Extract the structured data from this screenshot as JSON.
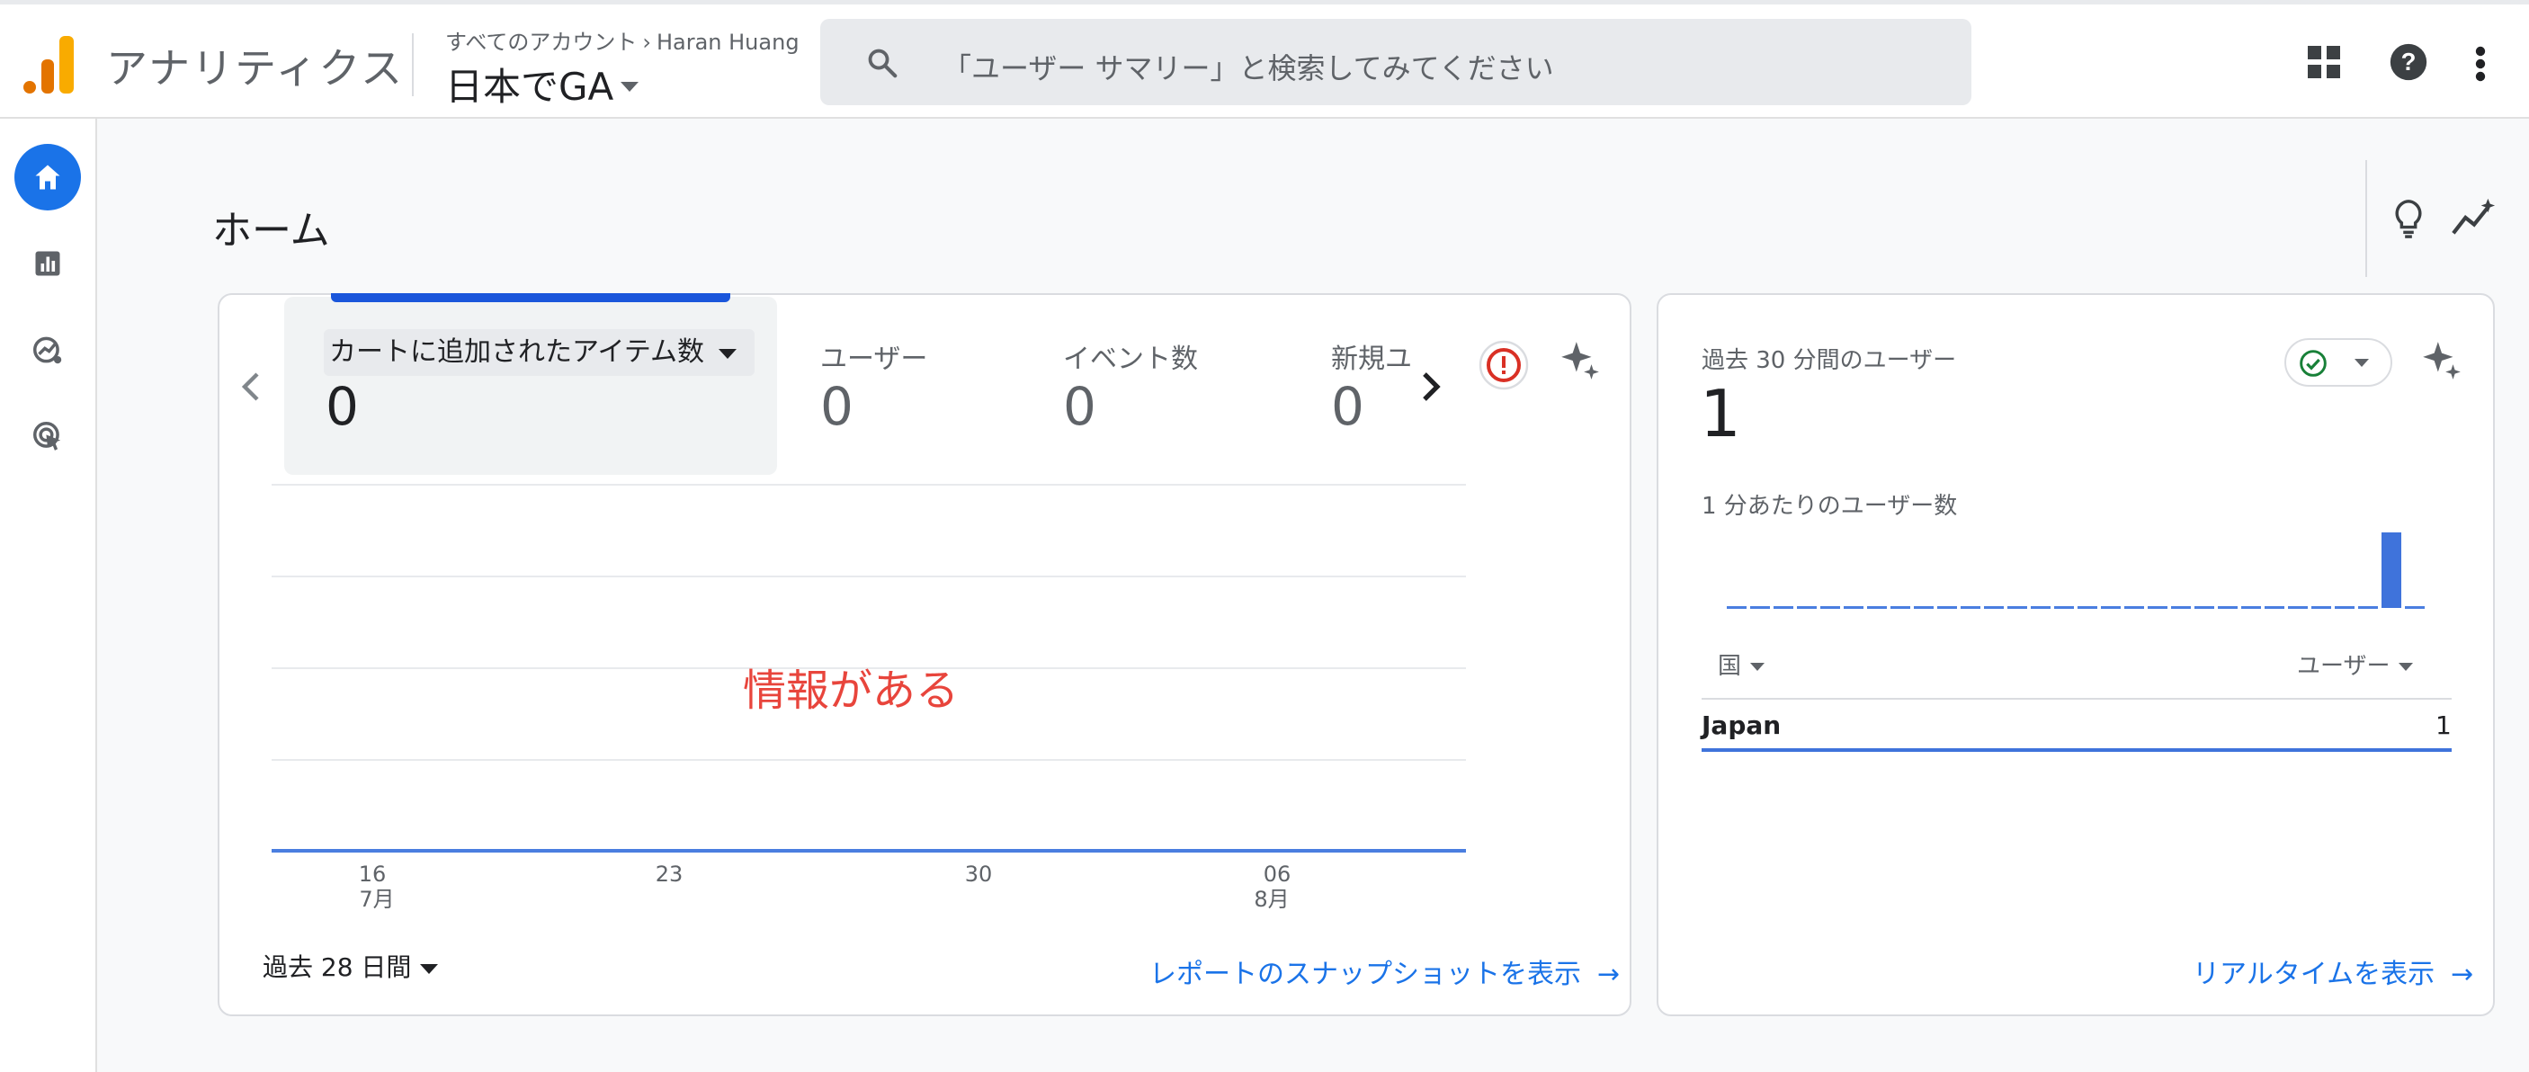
{
  "header": {
    "product_name": "アナリティクス",
    "breadcrumb_root": "すべてのアカウント",
    "breadcrumb_separator": "›",
    "account_name": "Haran Huang",
    "property_name": "日本でGA",
    "search_placeholder": "「ユーザー サマリー」と検索してみてください",
    "icons": [
      "search-icon",
      "apps-grid-icon",
      "help-icon",
      "more-vert-icon"
    ]
  },
  "nav": {
    "items": [
      {
        "icon": "home-icon",
        "active": true
      },
      {
        "icon": "reports-icon",
        "active": false
      },
      {
        "icon": "explore-icon",
        "active": false
      },
      {
        "icon": "advertising-icon",
        "active": false
      }
    ]
  },
  "page": {
    "title": "ホーム",
    "icons": [
      "insights-lightbulb-icon",
      "trend-sparkle-icon"
    ]
  },
  "overview_card": {
    "selected_metric": {
      "label": "カートに追加されたアイテム数",
      "value": "0"
    },
    "metrics": [
      {
        "label": "ユーザー",
        "value": "0"
      },
      {
        "label": "イベント数",
        "value": "0"
      },
      {
        "label": "新規ユ",
        "value": "0"
      }
    ],
    "overlay_text": "情報がある",
    "date_range": "過去 28 日間",
    "link_text": "レポートのスナップショットを表示",
    "chart_data": {
      "type": "line",
      "x": [
        "16",
        "23",
        "30",
        "06"
      ],
      "x_months": {
        "16": "7月",
        "06": "8月"
      },
      "series": [
        {
          "values": [
            0,
            0,
            0,
            0
          ]
        }
      ],
      "grid": true
    }
  },
  "realtime_card": {
    "title": "過去 30 分間のユーザー",
    "value": "1",
    "per_minute_label": "1 分あたりのユーザー数",
    "chart_data": {
      "type": "bar",
      "values": [
        0,
        0,
        0,
        0,
        0,
        0,
        0,
        0,
        0,
        0,
        0,
        0,
        0,
        0,
        0,
        0,
        0,
        0,
        0,
        0,
        0,
        0,
        0,
        0,
        0,
        0,
        0,
        0,
        1,
        0
      ]
    },
    "table": {
      "columns": [
        "国",
        "ユーザー"
      ],
      "rows": [
        {
          "country": "Japan",
          "users": "1"
        }
      ]
    },
    "link_text": "リアルタイムを表示"
  },
  "colors": {
    "accent": "#1a73e8",
    "alert": "#d93025",
    "ok": "#188038",
    "overlay": "#e8453c"
  }
}
